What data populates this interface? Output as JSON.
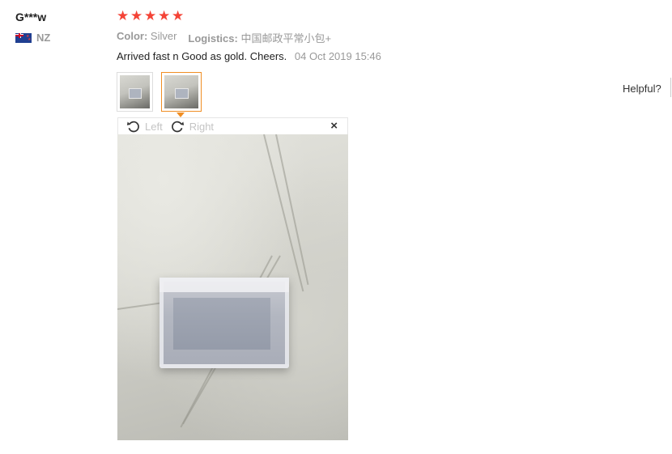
{
  "review": {
    "user_name": "G***w",
    "country_code": "NZ",
    "rating": 5,
    "attributes": [
      {
        "label": "Color:",
        "value": "Silver"
      },
      {
        "label": "Logistics:",
        "value": "中国邮政平常小包+"
      }
    ],
    "text": "Arrived fast n Good as gold. Cheers.",
    "date": "04 Oct 2019 15:46",
    "helpful_label": "Helpful?"
  },
  "viewer": {
    "rotate_left_label": "Left",
    "rotate_right_label": "Right",
    "close_symbol": "×"
  },
  "colors": {
    "star": "#f44336",
    "active_thumb_border": "#f08e24",
    "muted_text": "#999999"
  },
  "icons": [
    "star-icon",
    "rotate-left-icon",
    "rotate-right-icon",
    "close-icon",
    "nz-flag-icon"
  ]
}
